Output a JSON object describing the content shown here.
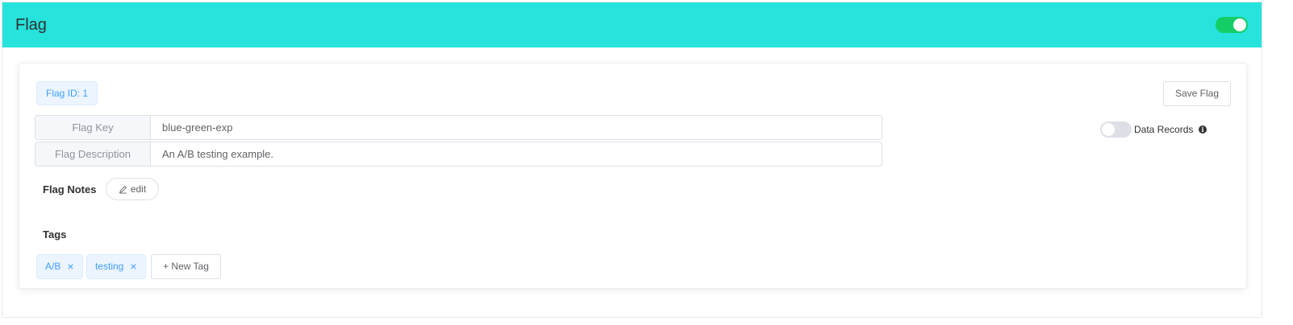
{
  "header": {
    "title": "Flag",
    "enabled": true
  },
  "flag": {
    "id_label": "Flag ID: 1",
    "save_label": "Save Flag",
    "key_label": "Flag Key",
    "key_value": "blue-green-exp",
    "description_label": "Flag Description",
    "description_value": "An A/B testing example.",
    "data_records_label": "Data Records",
    "data_records_enabled": false,
    "notes_label": "Flag Notes",
    "edit_label": "edit"
  },
  "tags": {
    "title": "Tags",
    "items": [
      {
        "label": "A/B"
      },
      {
        "label": "testing"
      }
    ],
    "new_tag_label": "+ New Tag"
  },
  "colors": {
    "header_bg": "#26e3dc",
    "switch_on": "#13ce66",
    "tag_text": "#409eff"
  }
}
